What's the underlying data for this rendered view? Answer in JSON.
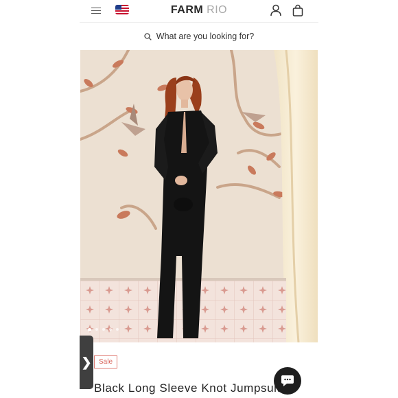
{
  "header": {
    "logo_primary": "FARM",
    "logo_secondary": "RIO",
    "menu_icon": "hamburger-menu-icon",
    "flag_icon": "us-flag-icon",
    "account_icon": "user-icon",
    "cart_icon": "shopping-bag-icon"
  },
  "search": {
    "placeholder": "What are you looking for?",
    "icon": "search-icon"
  },
  "gallery": {
    "image_count": 5,
    "active_index": 0,
    "side_tab_glyph": "❯"
  },
  "product": {
    "badge": "Sale",
    "title": "Black Long Sleeve Knot Jumpsuit"
  },
  "chat": {
    "icon": "chat-bubble-icon"
  },
  "colors": {
    "sale_accent": "#d9655b",
    "dark": "#1f1f1f",
    "logo_secondary": "#a9a9a9"
  }
}
